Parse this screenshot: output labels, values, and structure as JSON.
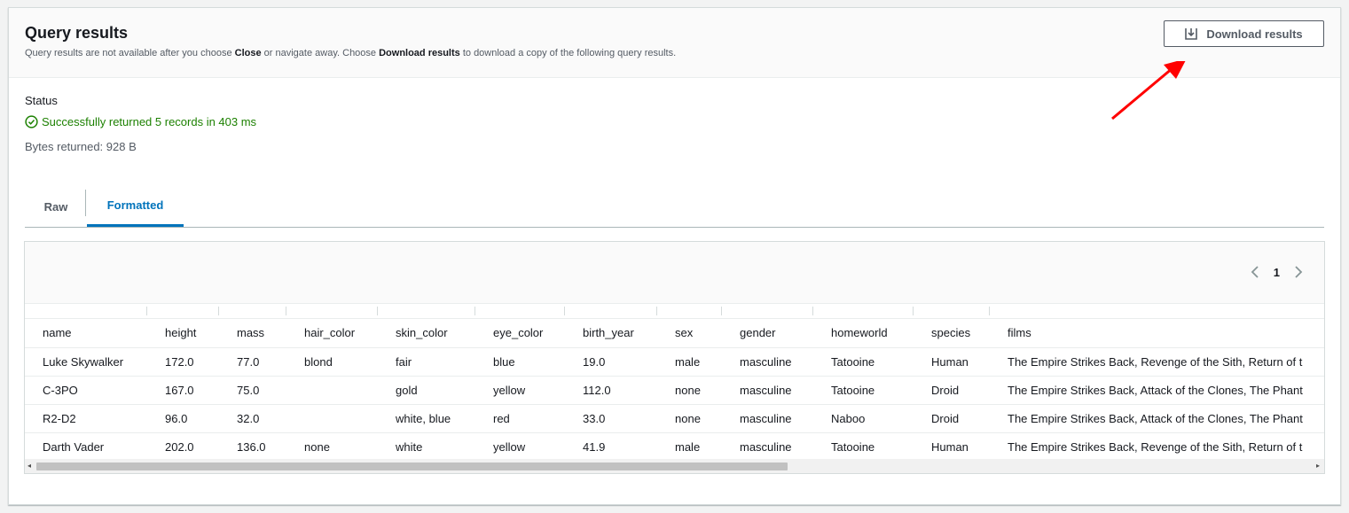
{
  "header": {
    "title": "Query results",
    "subtitle_part1": "Query results are not available after you choose ",
    "subtitle_bold1": "Close",
    "subtitle_part2": " or navigate away. Choose ",
    "subtitle_bold2": "Download results",
    "subtitle_part3": " to download a copy of the following query results.",
    "download_button_label": "Download results",
    "download_icon": "download-icon",
    "annotation_arrow_color": "#ff0000"
  },
  "status": {
    "label": "Status",
    "message": "Successfully returned 5 records in 403 ms",
    "success_icon": "check-circle-icon",
    "success_color": "#1d8102",
    "bytes_returned": "Bytes returned: 928 B"
  },
  "tabs": [
    {
      "label": "Raw",
      "active": false
    },
    {
      "label": "Formatted",
      "active": true
    }
  ],
  "accent_color": "#0073bb",
  "pagination": {
    "current_page": "1",
    "prev_icon": "chevron-left-icon",
    "next_icon": "chevron-right-icon"
  },
  "table": {
    "columns": [
      "name",
      "height",
      "mass",
      "hair_color",
      "skin_color",
      "eye_color",
      "birth_year",
      "sex",
      "gender",
      "homeworld",
      "species",
      "films"
    ],
    "rows": [
      [
        "Luke Skywalker",
        "172.0",
        "77.0",
        "blond",
        "fair",
        "blue",
        "19.0",
        "male",
        "masculine",
        "Tatooine",
        "Human",
        "The Empire Strikes Back, Revenge of the Sith, Return of t"
      ],
      [
        "C-3PO",
        "167.0",
        "75.0",
        "",
        "gold",
        "yellow",
        "112.0",
        "none",
        "masculine",
        "Tatooine",
        "Droid",
        "The Empire Strikes Back, Attack of the Clones, The Phant"
      ],
      [
        "R2-D2",
        "96.0",
        "32.0",
        "",
        "white, blue",
        "red",
        "33.0",
        "none",
        "masculine",
        "Naboo",
        "Droid",
        "The Empire Strikes Back, Attack of the Clones, The Phant"
      ],
      [
        "Darth Vader",
        "202.0",
        "136.0",
        "none",
        "white",
        "yellow",
        "41.9",
        "male",
        "masculine",
        "Tatooine",
        "Human",
        "The Empire Strikes Back, Revenge of the Sith, Return of t"
      ]
    ]
  }
}
